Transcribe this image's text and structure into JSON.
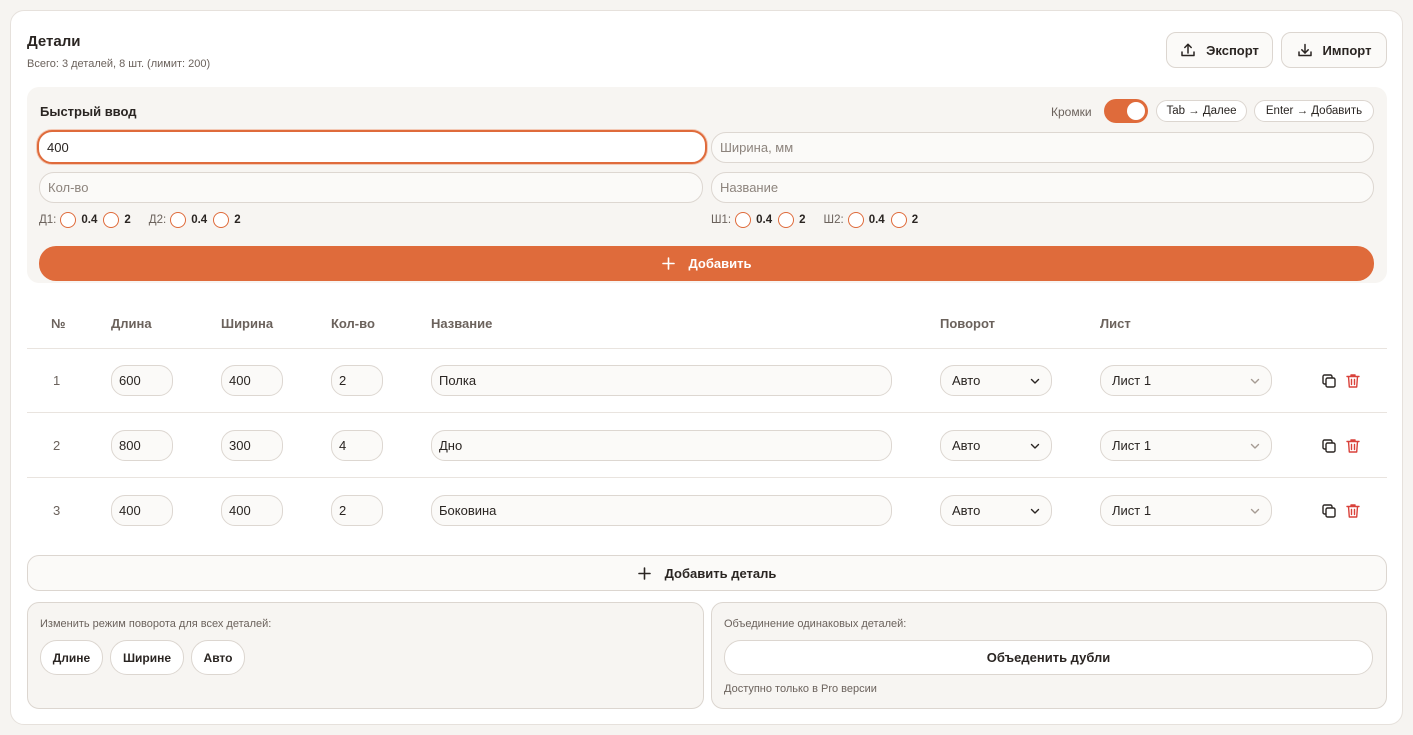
{
  "header": {
    "title": "Детали",
    "subtitle": "Всего: 3 деталей, 8 шт. (лимит: 200)",
    "export_label": "Экспорт",
    "import_label": "Импорт"
  },
  "quick_input": {
    "title": "Быстрый ввод",
    "edges_label": "Кромки",
    "edges_enabled": true,
    "hint_tab": "Tab → Далее",
    "hint_enter": "Enter → Добавить",
    "length_value": "400",
    "width_placeholder": "Ширина, мм",
    "qty_placeholder": "Кол-во",
    "name_placeholder": "Название",
    "edges_left": [
      {
        "label": "Д1:",
        "opt1": "0.4",
        "opt2": "2"
      },
      {
        "label": "Д2:",
        "opt1": "0.4",
        "opt2": "2"
      }
    ],
    "edges_right": [
      {
        "label": "Ш1:",
        "opt1": "0.4",
        "opt2": "2"
      },
      {
        "label": "Ш2:",
        "opt1": "0.4",
        "opt2": "2"
      }
    ],
    "add_label": "Добавить"
  },
  "table": {
    "columns": [
      "№",
      "Длина",
      "Ширина",
      "Кол-во",
      "Название",
      "Поворот",
      "Лист"
    ],
    "rows": [
      {
        "num": "1",
        "length": "600",
        "width": "400",
        "qty": "2",
        "name": "Полка",
        "rotation": "Авто",
        "sheet": "Лист 1"
      },
      {
        "num": "2",
        "length": "800",
        "width": "300",
        "qty": "4",
        "name": "Дно",
        "rotation": "Авто",
        "sheet": "Лист 1"
      },
      {
        "num": "3",
        "length": "400",
        "width": "400",
        "qty": "2",
        "name": "Боковина",
        "rotation": "Авто",
        "sheet": "Лист 1"
      }
    ],
    "add_detail_label": "Добавить деталь"
  },
  "rotation_panel": {
    "title": "Изменить режим поворота для всех деталей:",
    "options": [
      "Длине",
      "Ширине",
      "Авто"
    ]
  },
  "merge_panel": {
    "title": "Объединение одинаковых деталей:",
    "button_label": "Объеденить дубли",
    "note": "Доступно только в Pro версии"
  },
  "colors": {
    "accent": "#df6b3b",
    "delete": "#d9413a"
  }
}
